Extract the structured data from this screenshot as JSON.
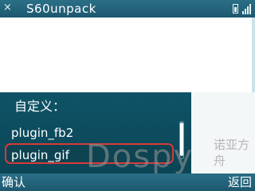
{
  "titlebar": {
    "app_title": "S60unpack",
    "close_glyph": "×",
    "icons": [
      "close-icon",
      "battery-icon",
      "signal-icon"
    ]
  },
  "popup": {
    "heading": "自定义：",
    "items": [
      {
        "label": "plugin_fb2",
        "selected": false
      },
      {
        "label": "plugin_gif",
        "selected": true
      }
    ]
  },
  "watermark": {
    "text": "Dospy",
    "cn_text": "诺亚方舟"
  },
  "softkeys": {
    "left": "确认",
    "right": "返回"
  },
  "colors": {
    "bar": "#1d5870",
    "popup_bg": "#0b4556",
    "selection_border": "#d63a3a"
  }
}
